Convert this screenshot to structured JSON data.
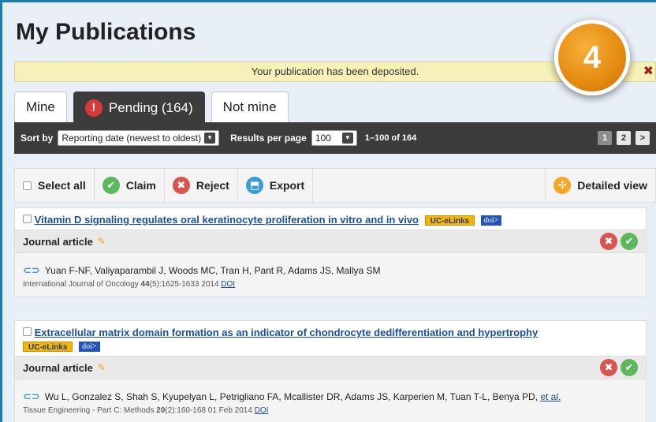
{
  "page_title": "My Publications",
  "notice": {
    "text": "Your publication has been deposited.",
    "close": "✖"
  },
  "step_badge": "4",
  "tabs": [
    {
      "label": "Mine"
    },
    {
      "label": "Pending (164)",
      "alert": "!"
    },
    {
      "label": "Not mine"
    }
  ],
  "toolbar": {
    "sort_label": "Sort by",
    "sort_value": "Reporting date (newest to oldest)",
    "rpp_label": "Results per page",
    "rpp_value": "100",
    "range": "1–100 of 164",
    "pages": [
      "1",
      "2",
      ">"
    ]
  },
  "actions": {
    "select_all": "Select all",
    "claim": "Claim",
    "reject": "Reject",
    "export": "Export",
    "detailed_view": "Detailed view"
  },
  "publications": [
    {
      "title": "Vitamin D signaling regulates oral keratinocyte proliferation in vitro and in vivo",
      "uc_elinks": "UC-eLinks",
      "doi_badge": "doi>",
      "type": "Journal article",
      "authors": "Yuan F-NF, Valiyaparambil J, Woods MC, Tran H, Pant R, Adams JS, Mallya SM",
      "journal_prefix": "International Journal of Oncology ",
      "volume": "44",
      "journal_suffix": "(5):1625-1633 2014 ",
      "doi_link": "DOI"
    },
    {
      "title": "Extracellular matrix domain formation as an indicator of chondrocyte dedifferentiation and hypertrophy",
      "uc_elinks": "UC-eLinks",
      "doi_badge": "doi>",
      "type": "Journal article",
      "authors": "Wu L, Gonzalez S, Shah S, Kyupelyan L, Petrigliano FA, Mcallister DR, Adams JS, Karperien M, Tuan T-L, Benya PD, ",
      "et_al": "et al.",
      "journal_prefix": "Tissue Engineering - Part C: Methods ",
      "volume": "20",
      "journal_suffix": "(2):160-168 01 Feb 2014 ",
      "doi_link": "DOI"
    }
  ],
  "colors": {
    "accent": "#1a7fb0",
    "toolbar_bg": "#3c3c3c",
    "notice_bg": "#f5f1b8",
    "badge": "#e58a10",
    "link": "#1a4fa0"
  }
}
